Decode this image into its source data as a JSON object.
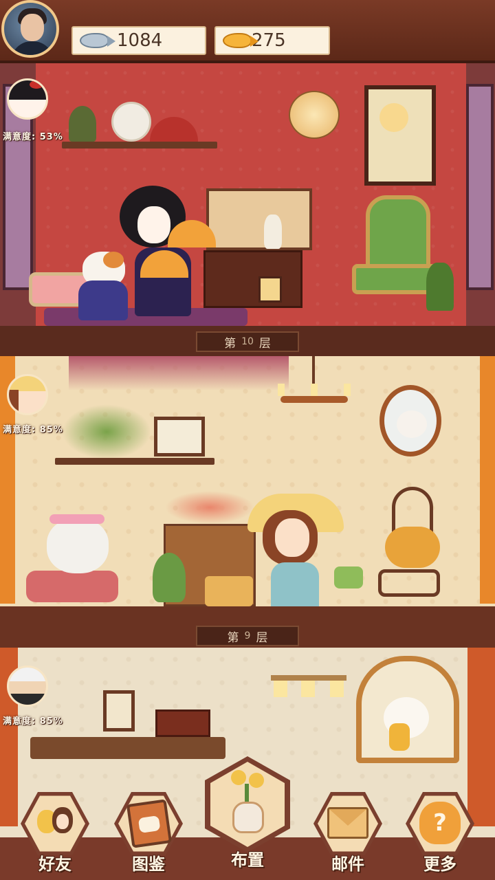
{
  "currencies": {
    "fish": {
      "value": "1084",
      "icon": "silver-fish-icon"
    },
    "gold_fish": {
      "value": "275",
      "icon": "gold-fish-icon"
    }
  },
  "floors": [
    {
      "label_prefix": "第",
      "number": "10",
      "label_suffix": "层",
      "satisfaction": "满意度: 53%"
    },
    {
      "label_prefix": "第",
      "number": "9",
      "label_suffix": "层",
      "satisfaction": "满意度: 85%"
    },
    {
      "satisfaction": "满意度: 85%"
    }
  ],
  "nav": {
    "friends": "好友",
    "collection": "图鉴",
    "decorate": "布置",
    "mail": "邮件",
    "more": "更多"
  },
  "colors": {
    "floor10_wall": "#c54741",
    "floor9_wall": "#f1ddb7",
    "floor8_wall": "#ece0c8",
    "frame": "#5a2b1e"
  }
}
